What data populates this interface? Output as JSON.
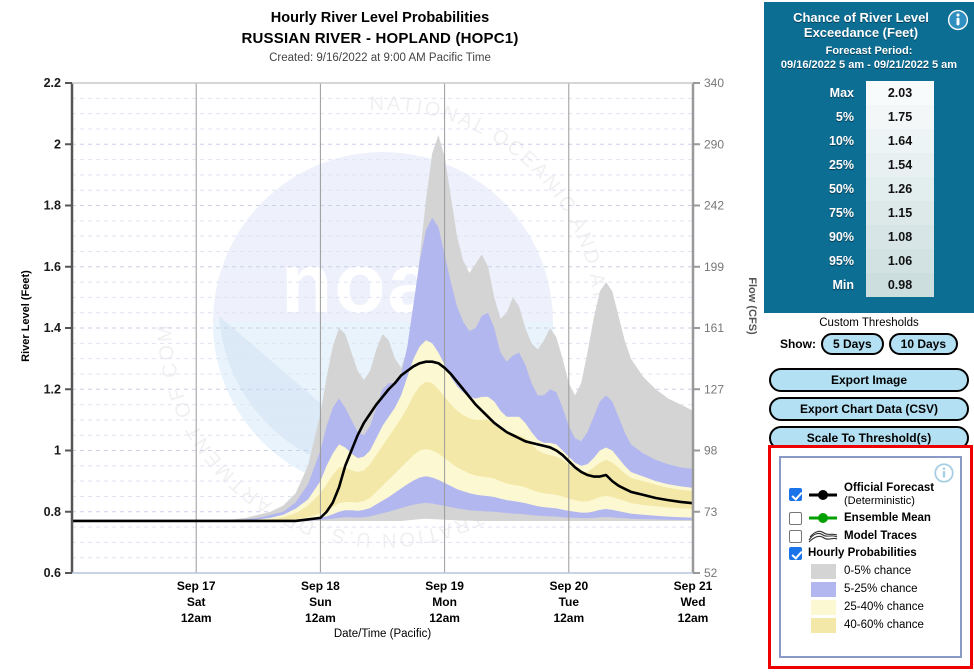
{
  "titles": {
    "main": "Hourly River Level Probabilities",
    "site": "RUSSIAN RIVER - HOPLAND (HOPC1)",
    "created": "Created: 9/16/2022 at 9:00 AM Pacific Time"
  },
  "axes": {
    "ylabel_left": "River Level (Feet)",
    "ylabel_right": "Flow (CFS)",
    "xlabel": "Date/Time (Pacific)",
    "y_left_ticks": [
      "2.2",
      "2",
      "1.8",
      "1.6",
      "1.4",
      "1.2",
      "1",
      "0.8",
      "0.6"
    ],
    "y_right_ticks": [
      "340",
      "290",
      "242",
      "199",
      "161",
      "127",
      "98",
      "73",
      "52"
    ],
    "x_ticks": [
      {
        "date": "Sep 17",
        "day": "Sat",
        "time": "12am"
      },
      {
        "date": "Sep 18",
        "day": "Sun",
        "time": "12am"
      },
      {
        "date": "Sep 19",
        "day": "Mon",
        "time": "12am"
      },
      {
        "date": "Sep 20",
        "day": "Tue",
        "time": "12am"
      },
      {
        "date": "Sep 21",
        "day": "Wed",
        "time": "12am"
      }
    ]
  },
  "exceedance": {
    "title_line1": "Chance of River Level",
    "title_line2": "Exceedance (Feet)",
    "period_label": "Forecast Period:",
    "period_value": "09/16/2022 5 am - 09/21/2022 5 am",
    "rows": [
      {
        "label": "Max",
        "value": "2.03"
      },
      {
        "label": "5%",
        "value": "1.75"
      },
      {
        "label": "10%",
        "value": "1.64"
      },
      {
        "label": "25%",
        "value": "1.54"
      },
      {
        "label": "50%",
        "value": "1.26"
      },
      {
        "label": "75%",
        "value": "1.15"
      },
      {
        "label": "90%",
        "value": "1.08"
      },
      {
        "label": "95%",
        "value": "1.06"
      },
      {
        "label": "Min",
        "value": "0.98"
      }
    ]
  },
  "controls": {
    "custom_thresholds": "Custom Thresholds",
    "show_label": "Show:",
    "days_5": "5 Days",
    "days_10": "10 Days",
    "export_image": "Export Image",
    "export_csv": "Export Chart Data (CSV)",
    "scale_threshold": "Scale To Threshold(s)"
  },
  "legend": {
    "items": [
      {
        "label": "Official Forecast",
        "sub": "(Deterministic)",
        "checked": true,
        "marker": "black-line-dot"
      },
      {
        "label": "Ensemble Mean",
        "sub": "",
        "checked": false,
        "marker": "green-line-dot"
      },
      {
        "label": "Model Traces",
        "sub": "",
        "checked": false,
        "marker": "traces"
      },
      {
        "label": "Hourly Probabilities",
        "sub": "",
        "checked": true,
        "marker": "none"
      }
    ],
    "swatches": [
      {
        "label": "0-5% chance",
        "color": "#d4d4d4"
      },
      {
        "label": "5-25% chance",
        "color": "#b3b7ef"
      },
      {
        "label": "25-40% chance",
        "color": "#fbf8d2"
      },
      {
        "label": "40-60% chance",
        "color": "#f4e8a8"
      }
    ]
  },
  "colors": {
    "panel_bg": "#0d6e94",
    "band_0_5": "#d4d4d4",
    "band_5_25": "#b3b7ef",
    "band_25_40": "#fbf8d2",
    "band_40_60": "#f4e8a8",
    "forecast_line": "#000000",
    "accent_red": "#ee0000",
    "button_fill": "#b3e0f2"
  },
  "chart_data": {
    "type": "area",
    "title": "Hourly River Level Probabilities",
    "subtitle": "RUSSIAN RIVER - HOPLAND (HOPC1)",
    "xlabel": "Date/Time (Pacific)",
    "ylabel": "River Level (Feet)",
    "ylabel_secondary": "Flow (CFS)",
    "ylim": [
      0.6,
      2.2
    ],
    "y_secondary_ticks": [
      52,
      73,
      98,
      127,
      161,
      199,
      242,
      290,
      340
    ],
    "grid": true,
    "legend_position": "bottom-right",
    "x_start": "09/16/2022 05:00",
    "x_end": "09/21/2022 05:00",
    "x_tick_positions_days": [
      1,
      2,
      3,
      4,
      5
    ],
    "x_unit": "days from 09/16/2022 5am",
    "x": [
      0,
      0.1,
      0.2,
      0.3,
      0.4,
      0.5,
      0.6,
      0.7,
      0.8,
      0.9,
      1.0,
      1.1,
      1.2,
      1.3,
      1.4,
      1.5,
      1.6,
      1.7,
      1.8,
      1.9,
      2.0,
      2.05,
      2.1,
      2.15,
      2.2,
      2.25,
      2.3,
      2.35,
      2.4,
      2.45,
      2.5,
      2.55,
      2.6,
      2.65,
      2.7,
      2.75,
      2.8,
      2.85,
      2.9,
      2.95,
      3.0,
      3.05,
      3.1,
      3.15,
      3.2,
      3.25,
      3.3,
      3.35,
      3.4,
      3.45,
      3.5,
      3.55,
      3.6,
      3.65,
      3.7,
      3.75,
      3.8,
      3.85,
      3.9,
      3.95,
      4.0,
      4.05,
      4.1,
      4.15,
      4.2,
      4.25,
      4.3,
      4.35,
      4.4,
      4.45,
      4.5,
      4.6,
      4.7,
      4.8,
      4.9,
      5.0
    ],
    "series": [
      {
        "name": "Official Forecast (Deterministic)",
        "type": "line",
        "color": "#000000",
        "values": [
          0.77,
          0.77,
          0.77,
          0.77,
          0.77,
          0.77,
          0.77,
          0.77,
          0.77,
          0.77,
          0.77,
          0.77,
          0.77,
          0.77,
          0.77,
          0.77,
          0.77,
          0.77,
          0.77,
          0.775,
          0.78,
          0.8,
          0.83,
          0.88,
          0.95,
          1.0,
          1.05,
          1.09,
          1.12,
          1.15,
          1.175,
          1.2,
          1.22,
          1.245,
          1.26,
          1.275,
          1.285,
          1.29,
          1.29,
          1.285,
          1.27,
          1.25,
          1.225,
          1.2,
          1.175,
          1.15,
          1.13,
          1.11,
          1.09,
          1.075,
          1.06,
          1.05,
          1.04,
          1.03,
          1.025,
          1.02,
          1.015,
          1.01,
          1.0,
          0.985,
          0.965,
          0.945,
          0.93,
          0.92,
          0.915,
          0.915,
          0.92,
          0.9,
          0.885,
          0.875,
          0.865,
          0.855,
          0.845,
          0.838,
          0.832,
          0.828
        ]
      },
      {
        "name": "0-5% chance (upper)",
        "type": "band-upper",
        "color": "#d4d4d4",
        "values": [
          0.77,
          0.77,
          0.77,
          0.77,
          0.77,
          0.77,
          0.77,
          0.77,
          0.77,
          0.77,
          0.77,
          0.77,
          0.77,
          0.775,
          0.78,
          0.79,
          0.8,
          0.82,
          0.86,
          0.95,
          1.12,
          1.24,
          1.34,
          1.4,
          1.38,
          1.32,
          1.26,
          1.23,
          1.26,
          1.33,
          1.38,
          1.36,
          1.3,
          1.27,
          1.33,
          1.46,
          1.63,
          1.82,
          1.97,
          2.03,
          1.96,
          1.83,
          1.7,
          1.62,
          1.58,
          1.61,
          1.64,
          1.6,
          1.5,
          1.43,
          1.45,
          1.5,
          1.47,
          1.4,
          1.35,
          1.33,
          1.36,
          1.4,
          1.37,
          1.3,
          1.22,
          1.18,
          1.22,
          1.32,
          1.43,
          1.52,
          1.55,
          1.52,
          1.44,
          1.36,
          1.3,
          1.24,
          1.2,
          1.17,
          1.15,
          1.13
        ]
      },
      {
        "name": "5-25% chance (upper)",
        "type": "band-upper",
        "color": "#b3b7ef",
        "values": [
          0.77,
          0.77,
          0.77,
          0.77,
          0.77,
          0.77,
          0.77,
          0.77,
          0.77,
          0.77,
          0.77,
          0.77,
          0.77,
          0.772,
          0.775,
          0.78,
          0.79,
          0.8,
          0.83,
          0.89,
          1.0,
          1.08,
          1.14,
          1.17,
          1.14,
          1.1,
          1.06,
          1.05,
          1.08,
          1.14,
          1.2,
          1.22,
          1.22,
          1.25,
          1.34,
          1.48,
          1.62,
          1.72,
          1.76,
          1.73,
          1.64,
          1.55,
          1.47,
          1.42,
          1.39,
          1.4,
          1.44,
          1.45,
          1.4,
          1.32,
          1.29,
          1.31,
          1.32,
          1.28,
          1.22,
          1.18,
          1.18,
          1.2,
          1.19,
          1.14,
          1.08,
          1.04,
          1.03,
          1.06,
          1.11,
          1.16,
          1.18,
          1.16,
          1.11,
          1.06,
          1.02,
          0.99,
          0.97,
          0.955,
          0.945,
          0.94
        ]
      },
      {
        "name": "25-40% chance (upper)",
        "type": "band-upper",
        "color": "#fbf8d2",
        "values": [
          0.77,
          0.77,
          0.77,
          0.77,
          0.77,
          0.77,
          0.77,
          0.77,
          0.77,
          0.77,
          0.77,
          0.77,
          0.77,
          0.77,
          0.772,
          0.775,
          0.78,
          0.79,
          0.81,
          0.84,
          0.9,
          0.95,
          0.99,
          1.02,
          1.01,
          0.99,
          0.975,
          0.98,
          1.0,
          1.04,
          1.08,
          1.11,
          1.14,
          1.18,
          1.24,
          1.3,
          1.34,
          1.36,
          1.35,
          1.32,
          1.28,
          1.24,
          1.21,
          1.19,
          1.175,
          1.17,
          1.175,
          1.175,
          1.16,
          1.13,
          1.11,
          1.11,
          1.11,
          1.09,
          1.06,
          1.035,
          1.025,
          1.025,
          1.02,
          1.0,
          0.98,
          0.96,
          0.95,
          0.955,
          0.975,
          1.0,
          1.01,
          1.0,
          0.975,
          0.95,
          0.93,
          0.915,
          0.9,
          0.89,
          0.883,
          0.878
        ]
      },
      {
        "name": "40-60% chance (upper)",
        "type": "band-upper",
        "color": "#f4e8a8",
        "values": [
          0.77,
          0.77,
          0.77,
          0.77,
          0.77,
          0.77,
          0.77,
          0.77,
          0.77,
          0.77,
          0.77,
          0.77,
          0.77,
          0.77,
          0.77,
          0.772,
          0.775,
          0.782,
          0.795,
          0.82,
          0.86,
          0.89,
          0.92,
          0.945,
          0.945,
          0.935,
          0.93,
          0.935,
          0.955,
          0.985,
          1.015,
          1.045,
          1.075,
          1.105,
          1.14,
          1.18,
          1.21,
          1.225,
          1.22,
          1.2,
          1.175,
          1.15,
          1.13,
          1.115,
          1.105,
          1.1,
          1.1,
          1.1,
          1.09,
          1.075,
          1.06,
          1.055,
          1.05,
          1.04,
          1.02,
          1.0,
          0.99,
          0.985,
          0.98,
          0.97,
          0.955,
          0.94,
          0.93,
          0.93,
          0.945,
          0.96,
          0.97,
          0.96,
          0.945,
          0.925,
          0.91,
          0.9,
          0.888,
          0.878,
          0.872,
          0.868
        ]
      },
      {
        "name": "40-60% chance (lower)",
        "type": "band-lower",
        "color": "#f4e8a8",
        "values": [
          0.77,
          0.77,
          0.77,
          0.77,
          0.77,
          0.77,
          0.77,
          0.77,
          0.77,
          0.77,
          0.77,
          0.77,
          0.77,
          0.77,
          0.77,
          0.77,
          0.77,
          0.772,
          0.775,
          0.782,
          0.795,
          0.805,
          0.815,
          0.828,
          0.832,
          0.832,
          0.83,
          0.835,
          0.845,
          0.865,
          0.885,
          0.905,
          0.925,
          0.945,
          0.965,
          0.985,
          1.0,
          1.005,
          1.0,
          0.99,
          0.975,
          0.96,
          0.945,
          0.935,
          0.925,
          0.918,
          0.915,
          0.912,
          0.908,
          0.9,
          0.892,
          0.888,
          0.885,
          0.88,
          0.872,
          0.865,
          0.86,
          0.858,
          0.855,
          0.85,
          0.843,
          0.838,
          0.834,
          0.834,
          0.84,
          0.848,
          0.852,
          0.848,
          0.842,
          0.835,
          0.828,
          0.822,
          0.818,
          0.814,
          0.811,
          0.809
        ]
      },
      {
        "name": "25-40% chance (lower)",
        "type": "band-lower",
        "color": "#fbf8d2",
        "values": [
          0.77,
          0.77,
          0.77,
          0.77,
          0.77,
          0.77,
          0.77,
          0.77,
          0.77,
          0.77,
          0.77,
          0.77,
          0.77,
          0.77,
          0.77,
          0.77,
          0.77,
          0.77,
          0.772,
          0.775,
          0.78,
          0.785,
          0.792,
          0.8,
          0.805,
          0.805,
          0.803,
          0.806,
          0.812,
          0.824,
          0.836,
          0.848,
          0.862,
          0.876,
          0.89,
          0.902,
          0.912,
          0.916,
          0.912,
          0.904,
          0.894,
          0.884,
          0.874,
          0.867,
          0.861,
          0.856,
          0.853,
          0.851,
          0.848,
          0.843,
          0.838,
          0.835,
          0.832,
          0.828,
          0.823,
          0.818,
          0.815,
          0.813,
          0.811,
          0.807,
          0.803,
          0.8,
          0.797,
          0.797,
          0.801,
          0.806,
          0.809,
          0.806,
          0.802,
          0.798,
          0.794,
          0.79,
          0.787,
          0.784,
          0.782,
          0.781
        ]
      },
      {
        "name": "5-25% chance (lower)",
        "type": "band-lower",
        "color": "#b3b7ef",
        "values": [
          0.77,
          0.77,
          0.77,
          0.77,
          0.77,
          0.77,
          0.77,
          0.77,
          0.77,
          0.77,
          0.77,
          0.77,
          0.77,
          0.77,
          0.77,
          0.77,
          0.77,
          0.77,
          0.77,
          0.771,
          0.773,
          0.775,
          0.777,
          0.78,
          0.782,
          0.782,
          0.781,
          0.782,
          0.785,
          0.79,
          0.795,
          0.8,
          0.806,
          0.812,
          0.818,
          0.823,
          0.827,
          0.829,
          0.827,
          0.823,
          0.819,
          0.815,
          0.811,
          0.808,
          0.805,
          0.803,
          0.802,
          0.801,
          0.8,
          0.798,
          0.796,
          0.794,
          0.793,
          0.791,
          0.789,
          0.787,
          0.786,
          0.785,
          0.784,
          0.782,
          0.781,
          0.78,
          0.779,
          0.779,
          0.78,
          0.782,
          0.783,
          0.782,
          0.78,
          0.779,
          0.777,
          0.776,
          0.775,
          0.774,
          0.773,
          0.773
        ]
      },
      {
        "name": "0-5% chance (lower)",
        "type": "band-lower",
        "color": "#d4d4d4",
        "values": [
          0.77,
          0.77,
          0.77,
          0.77,
          0.77,
          0.77,
          0.77,
          0.77,
          0.77,
          0.77,
          0.77,
          0.77,
          0.77,
          0.77,
          0.77,
          0.77,
          0.77,
          0.77,
          0.77,
          0.77,
          0.77,
          0.77,
          0.77,
          0.77,
          0.77,
          0.77,
          0.77,
          0.77,
          0.77,
          0.77,
          0.77,
          0.77,
          0.77,
          0.77,
          0.772,
          0.774,
          0.776,
          0.777,
          0.776,
          0.775,
          0.774,
          0.773,
          0.772,
          0.771,
          0.771,
          0.77,
          0.77,
          0.77,
          0.77,
          0.77,
          0.77,
          0.77,
          0.77,
          0.77,
          0.77,
          0.77,
          0.77,
          0.77,
          0.77,
          0.77,
          0.77,
          0.77,
          0.77,
          0.77,
          0.77,
          0.77,
          0.77,
          0.77,
          0.77,
          0.77,
          0.77,
          0.77,
          0.77,
          0.77,
          0.77,
          0.77
        ]
      }
    ],
    "annotations": [
      {
        "text": "noaa",
        "type": "watermark"
      },
      {
        "text": "NATIONAL OCEANIC AND ATMOSPHERIC ADMINISTRATION U.S. DEPARTMENT OF COMMERCE",
        "type": "watermark-ring"
      }
    ]
  }
}
